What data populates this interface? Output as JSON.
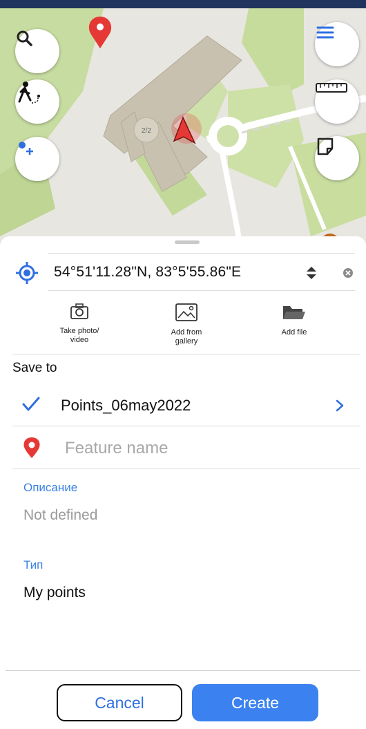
{
  "map": {
    "building_floor_label": "2/2",
    "buttons": {
      "search": "search-icon",
      "track": "walking-track-icon",
      "add_point": "add-point-icon",
      "menu": "menu-icon",
      "ruler": "ruler-icon",
      "area": "area-measure-icon"
    }
  },
  "coordinates": {
    "value": "54°51'11.28\"N, 83°5'55.86\"E"
  },
  "attachments": [
    {
      "label": "Take photo/\nvideo",
      "icon": "camera-icon"
    },
    {
      "label": "Add from\ngallery",
      "icon": "gallery-icon"
    },
    {
      "label": "Add file",
      "icon": "folder-icon"
    }
  ],
  "save_to": {
    "label": "Save to",
    "layer_name": "Points_06may2022"
  },
  "feature": {
    "name_placeholder": "Feature name",
    "name_value": ""
  },
  "fields": [
    {
      "label": "Описание",
      "value": "Not defined"
    },
    {
      "label": "Тип",
      "value": "My points"
    }
  ],
  "actions": {
    "cancel": "Cancel",
    "create": "Create"
  },
  "colors": {
    "accent": "#3b82f0",
    "pin": "#e53935",
    "header": "#20325e"
  }
}
